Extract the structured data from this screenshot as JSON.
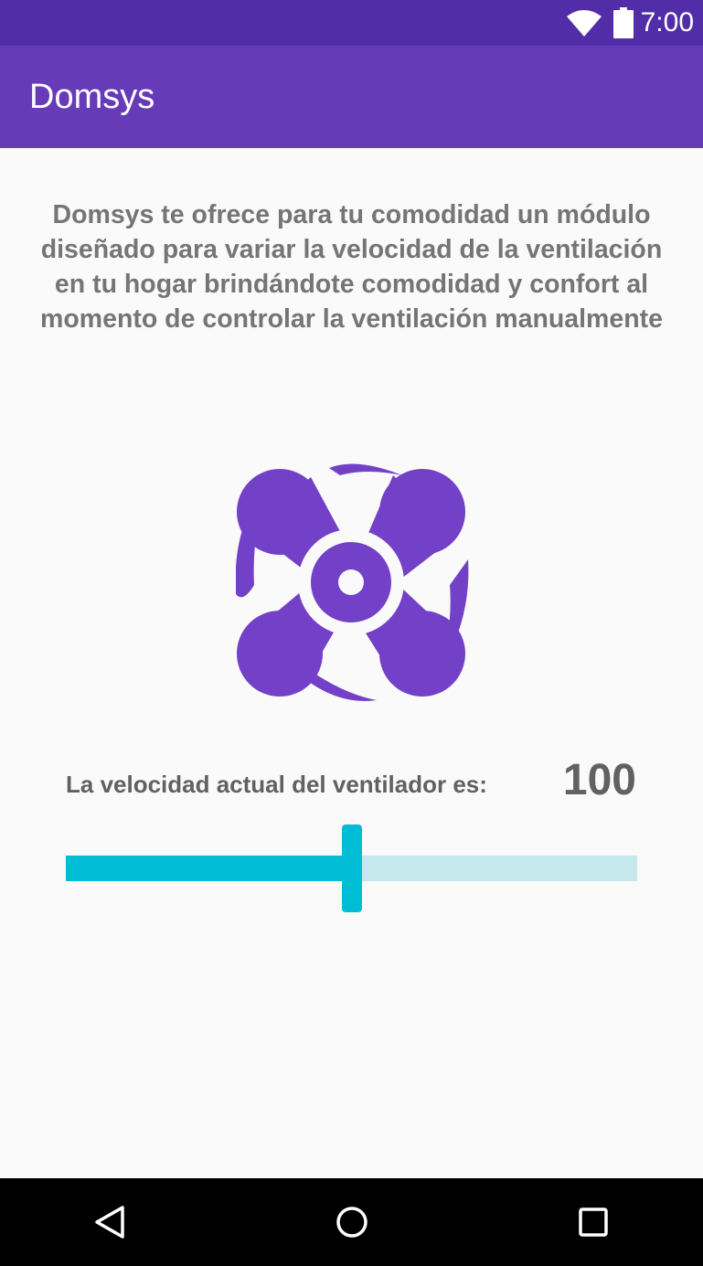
{
  "status_bar": {
    "time": "7:00",
    "icons": [
      "wifi-icon",
      "battery-icon"
    ],
    "background": "#512da8"
  },
  "app_bar": {
    "title": "Domsys",
    "background": "#673ab7"
  },
  "description": "Domsys te ofrece para tu comodidad un módulo diseñado para variar la velocidad de la ventilación en tu hogar brindándote comodidad y confort al momento de controlar la ventilación manualmente",
  "fan_icon": {
    "name": "fan-icon",
    "color": "#7340c8"
  },
  "speed": {
    "label": "La velocidad actual del ventilador es:",
    "value": "100",
    "slider_fraction": 0.5,
    "accent": "#00bcd4",
    "track_color": "#c4e8ec"
  },
  "nav_bar": {
    "icons": [
      "back-icon",
      "home-icon",
      "recents-icon"
    ]
  }
}
